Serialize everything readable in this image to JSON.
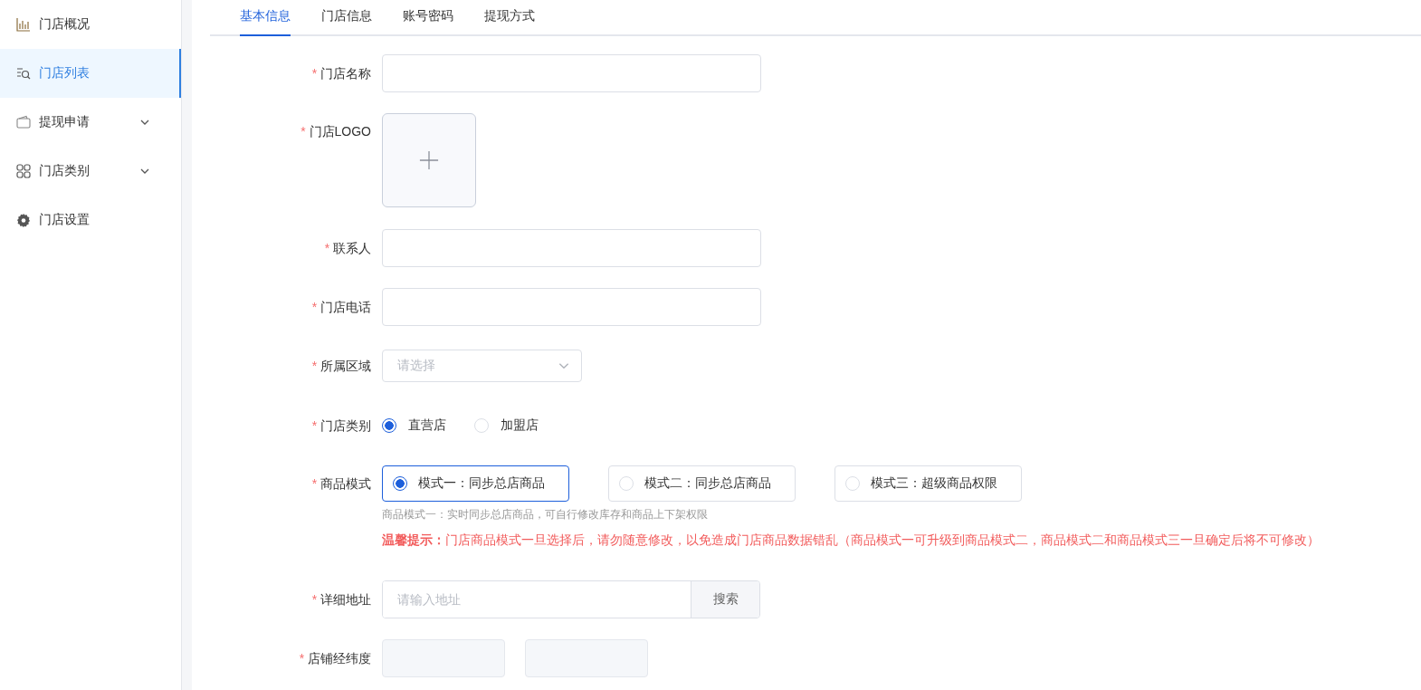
{
  "sidebar": {
    "items": [
      {
        "label": "门店概况",
        "kind": "link",
        "selected": false
      },
      {
        "label": "门店列表",
        "kind": "link",
        "selected": true
      },
      {
        "label": "提现申请",
        "kind": "group",
        "selected": false,
        "expanded": false
      },
      {
        "label": "门店类别",
        "kind": "group",
        "selected": false,
        "expanded": false
      },
      {
        "label": "门店设置",
        "kind": "link",
        "selected": false
      }
    ]
  },
  "tabs": [
    {
      "label": "基本信息",
      "selected": true
    },
    {
      "label": "门店信息",
      "selected": false
    },
    {
      "label": "账号密码",
      "selected": false
    },
    {
      "label": "提现方式",
      "selected": false
    }
  ],
  "form": {
    "fields": [
      {
        "kind": "text",
        "required_mark": "*",
        "label": "门店名称"
      },
      {
        "kind": "upload",
        "required_mark": "*",
        "label": "门店LOGO"
      },
      {
        "kind": "text",
        "required_mark": "*",
        "label": "联系人"
      },
      {
        "kind": "text",
        "required_mark": "*",
        "label": "门店电话"
      },
      {
        "kind": "select",
        "required_mark": "*",
        "label": "所属区域",
        "placeholder": "请选择"
      },
      {
        "kind": "radio",
        "required_mark": "*",
        "label": "门店类别",
        "options": [
          {
            "label": "直营店",
            "selected": true
          },
          {
            "label": "加盟店",
            "selected": false
          }
        ]
      },
      {
        "kind": "cards",
        "required_mark": "*",
        "label": "商品模式",
        "options": [
          {
            "label": "模式一：同步总店商品",
            "selected": true
          },
          {
            "label": "模式二：同步总店商品",
            "selected": false
          },
          {
            "label": "模式三：超级商品权限",
            "selected": false
          }
        ],
        "hint": "商品模式一：实时同步总店商品，可自行修改库存和商品上下架权限",
        "warning": "**温馨提示：**门店商品模式一旦选择后，请勿随意修改，以免造成门店商品数据错乱（商品模式一可升级到商品模式二，商品模式二和商品模式三一旦确定后将不可修改）"
      },
      {
        "kind": "address",
        "required_mark": "*",
        "label": "详细地址",
        "placeholder": "请输入地址",
        "button": "搜索"
      },
      {
        "kind": "coords",
        "required_mark": "*",
        "label": "店铺经纬度"
      }
    ]
  }
}
